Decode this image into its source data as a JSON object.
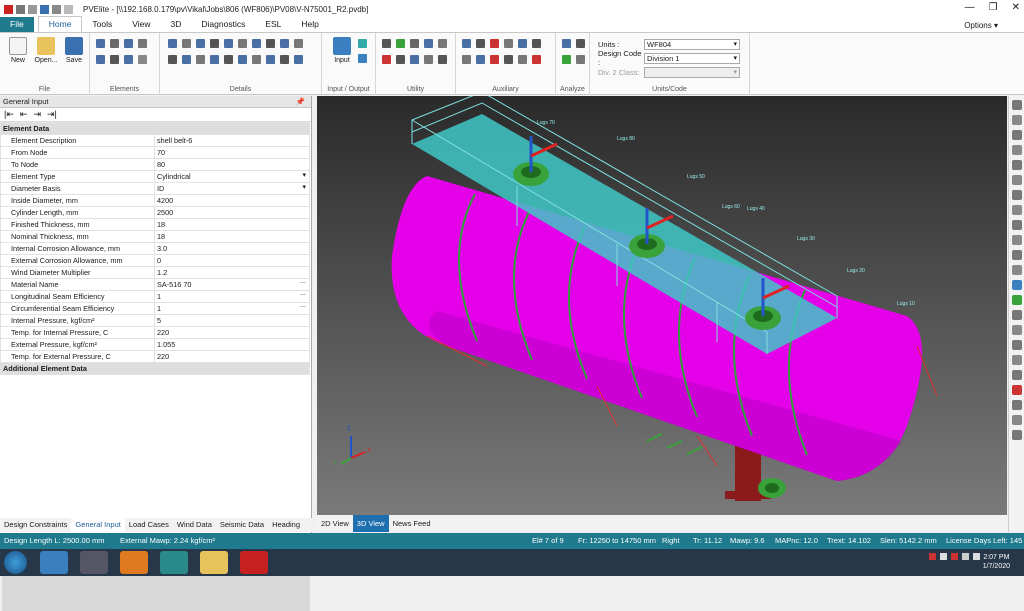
{
  "window": {
    "title": "PVElite - [\\\\192.168.0.179\\pv\\Vikal\\Jobs\\806 (WF806)\\PV08\\V-N75001_R2.pvdb]",
    "min": "—",
    "max": "❐",
    "close": "✕"
  },
  "menu": {
    "file": "File",
    "tabs": [
      "Home",
      "Tools",
      "View",
      "3D",
      "Diagnostics",
      "ESL",
      "Help"
    ],
    "options": "Options ▾"
  },
  "ribbon": {
    "file_group": {
      "label": "File",
      "new": "New",
      "open": "Open...",
      "save": "Save"
    },
    "elements_label": "Elements",
    "details_label": "Details",
    "io_group": {
      "label": "Input / Output",
      "input": "Input"
    },
    "utility_label": "Utility",
    "auxiliary_label": "Auxiliary",
    "analyze_label": "Analyze",
    "units_group": {
      "label": "Units/Code",
      "units_label": "Units :",
      "units_value": "WF804",
      "code_label": "Design Code :",
      "code_value": "Division 1",
      "div2_label": "Div. 2 Class:",
      "div2_value": ""
    }
  },
  "left_panel": {
    "header": "General Input",
    "pin": "📌",
    "nav_icons": [
      "|⇤",
      "⇤",
      "⇥",
      "⇥|"
    ],
    "section_title": "Element Data",
    "rows": [
      {
        "label": "Element Description",
        "value": "shell belt-6"
      },
      {
        "label": "From Node",
        "value": "70"
      },
      {
        "label": "To Node",
        "value": "80"
      },
      {
        "label": "Element Type",
        "value": "Cylindrical"
      },
      {
        "label": "Diameter Basis",
        "value": "ID"
      },
      {
        "label": "Inside Diameter, mm",
        "value": "4200"
      },
      {
        "label": "Cylinder Length, mm",
        "value": "2500"
      },
      {
        "label": "Finished Thickness, mm",
        "value": "18"
      },
      {
        "label": "Nominal Thickness, mm",
        "value": "18"
      },
      {
        "label": "Internal Corrosion Allowance, mm",
        "value": "3.0"
      },
      {
        "label": "External Corrosion Allowance, mm",
        "value": "0"
      },
      {
        "label": "Wind Diameter Multiplier",
        "value": "1.2"
      },
      {
        "label": "Material Name",
        "value": "SA-516 70"
      },
      {
        "label": "Longitudinal Seam Efficiency",
        "value": "1"
      },
      {
        "label": "Circumferential Seam Efficiency",
        "value": "1"
      },
      {
        "label": "Internal Pressure, kgf/cm²",
        "value": "5"
      },
      {
        "label": "Temp. for Internal Pressure, C",
        "value": "220"
      },
      {
        "label": "External Pressure, kgf/cm²",
        "value": "1.055"
      },
      {
        "label": "Temp. for External Pressure, C",
        "value": "220"
      }
    ],
    "section2_title": "Additional Element Data",
    "bottom_tabs": [
      "Design Constraints",
      "General Input",
      "Load Cases",
      "Wind Data",
      "Seismic Data",
      "Heading"
    ]
  },
  "view_tabs": [
    "2D View",
    "3D View",
    "News Feed"
  ],
  "model_labels": [
    "Lugs 70",
    "Lugs 80",
    "Lugs 50",
    "Lugs 40",
    "Lugs 30",
    "Lugs 20",
    "Lugs 10",
    "Lugs 60"
  ],
  "axis": {
    "x": "X",
    "y": "Y",
    "z": "Z"
  },
  "status": {
    "design_length": "Design Length L: 2500.00 mm",
    "ext_mawp": "External Mawp: 2.24 kgf/cm²",
    "element": "El# 7 of 9",
    "from_to": "Fr: 12250 to 14750 mm",
    "side": "Right",
    "tr": "Tr: 11.12",
    "mawp": "Mawp: 9.6",
    "mapnc": "MAPnc: 12.0",
    "trext": "Trext: 14.102",
    "slen": "Slen: 5142.2 mm",
    "license": "License Days Left: 145"
  },
  "clock": {
    "time": "2:07 PM",
    "date": "1/7/2020"
  },
  "colors": {
    "accent": "#1e7a8c",
    "vessel": "#e400e8",
    "platform": "#3fc7c7",
    "nozzle": "#3aa23a",
    "saddle": "#8b1a1a"
  }
}
